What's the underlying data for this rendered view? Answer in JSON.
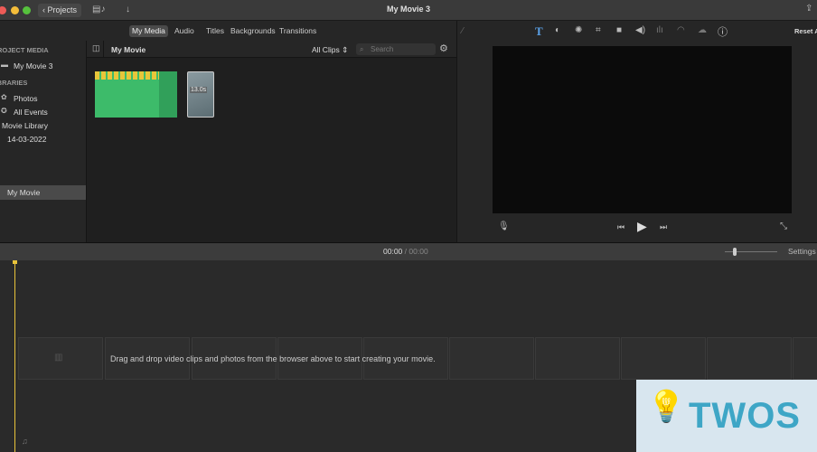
{
  "window": {
    "title": "My Movie 3",
    "projects_button": "Projects"
  },
  "tabs": [
    {
      "label": "My Media",
      "active": true
    },
    {
      "label": "Audio"
    },
    {
      "label": "Titles"
    },
    {
      "label": "Backgrounds"
    },
    {
      "label": "Transitions"
    }
  ],
  "sidebar": {
    "project_media_header": "PROJECT MEDIA",
    "project": "My Movie 3",
    "libraries_header": "LIBRARIES",
    "items": [
      "Photos",
      "All Events",
      "Movie Library",
      "14-03-2022",
      "My Movie"
    ]
  },
  "browser": {
    "title": "My Movie",
    "filter": "All Clips",
    "search_placeholder": "Search",
    "clips": [
      {
        "type": "video"
      },
      {
        "type": "photo",
        "duration": "13.0s"
      }
    ]
  },
  "viewer": {
    "reset_label": "Reset All",
    "tools": [
      "magic-wand",
      "titles",
      "color-balance",
      "color-correction",
      "crop",
      "stabilization",
      "volume",
      "noise-reduction",
      "speed",
      "video-overlay",
      "info"
    ]
  },
  "timeline": {
    "current_time": "00:00",
    "separator": "/",
    "total_time": "00:00",
    "settings_label": "Settings",
    "empty_message": "Drag and drop video clips and photos from the browser above to start creating your movie."
  },
  "watermark": {
    "text": "TWOS"
  },
  "colors": {
    "accent": "#5aa0e6",
    "playhead": "#e8c33a",
    "clip_green": "#3dbb6a"
  }
}
